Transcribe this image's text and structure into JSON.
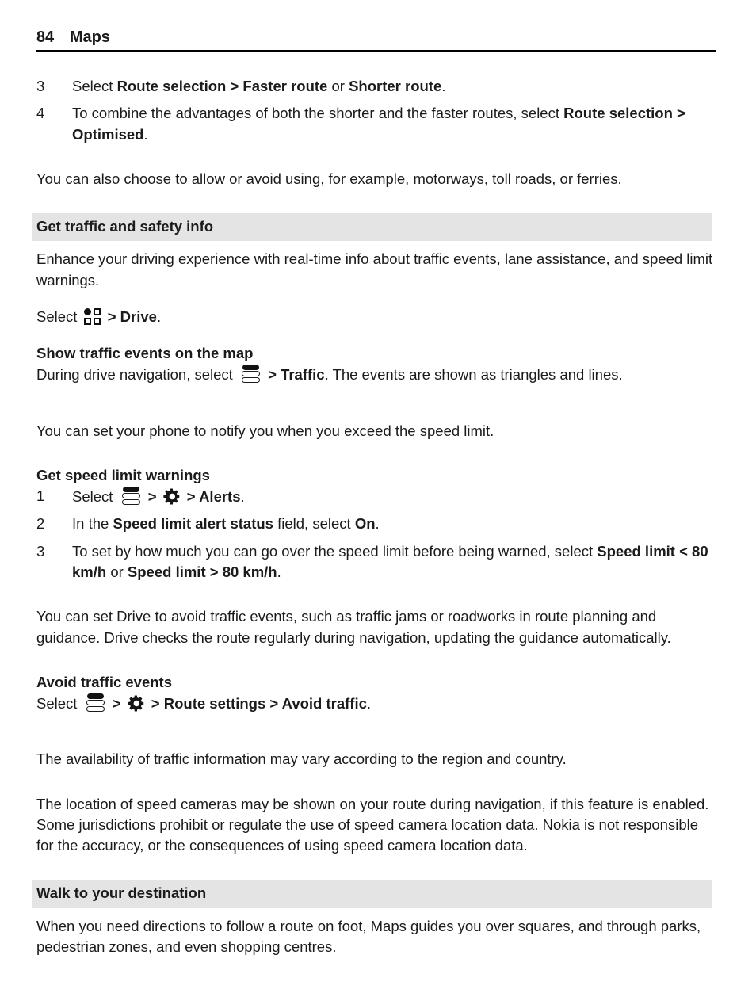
{
  "header": {
    "page_number": "84",
    "title": "Maps"
  },
  "icons": {
    "app_grid": "app-grid-icon",
    "drive_menu": "drive-menu-icon",
    "settings_gear": "gear-icon"
  },
  "content": {
    "step3_prefix": "Select ",
    "step3_bold1": "Route selection",
    "step3_sep1": " > ",
    "step3_bold2": "Faster route",
    "step3_mid": " or ",
    "step3_bold3": "Shorter route",
    "step3_suffix": ".",
    "step3_num": "3",
    "step4_num": "4",
    "step4_line1": "To combine the advantages of both the shorter and the faster routes, select",
    "step4_bold1": "Route selection",
    "step4_sep1": " > ",
    "step4_bold2": "Optimised",
    "step4_suffix": ".",
    "para_allow_avoid": "You can also choose to allow or avoid using, for example, motorways, toll roads, or ferries.",
    "heading_traffic_safety": "Get traffic and safety info",
    "para_enhance": "Enhance your driving experience with real-time info about traffic events, lane assistance, and speed limit warnings.",
    "select_word": "Select",
    "drive_sep": " > ",
    "drive_bold": "Drive",
    "drive_suffix": ".",
    "subheading_show_traffic": "Show traffic events on the map",
    "show_traffic_prefix": "During drive navigation, select ",
    "show_traffic_sep": " > ",
    "show_traffic_bold": "Traffic",
    "show_traffic_suffix": ". The events are shown as triangles and lines.",
    "para_notify_speed": "You can set your phone to notify you when you exceed the speed limit.",
    "subheading_speed_warnings": "Get speed limit warnings",
    "sl_step1_num": "1",
    "sl_step1_prefix": "Select ",
    "sl_step1_sep1": " > ",
    "sl_step1_sep2": " > ",
    "sl_step1_bold": "Alerts",
    "sl_step1_suffix": ".",
    "sl_step2_num": "2",
    "sl_step2_prefix": "In the ",
    "sl_step2_bold1": "Speed limit alert status",
    "sl_step2_mid": " field, select ",
    "sl_step2_bold2": "On",
    "sl_step2_suffix": ".",
    "sl_step3_num": "3",
    "sl_step3_line1": "To set by how much you can go over the speed limit before being warned, select",
    "sl_step3_bold1": "Speed limit < 80 km/h",
    "sl_step3_mid": " or ",
    "sl_step3_bold2": "Speed limit > 80 km/h",
    "sl_step3_suffix": ".",
    "para_avoid_intro": "You can set Drive to avoid traffic events, such as traffic jams or roadworks in route planning and guidance. Drive checks the route regularly during navigation, updating the guidance automatically.",
    "subheading_avoid_traffic": "Avoid traffic events",
    "avoid_prefix": "Select ",
    "avoid_sep1": " > ",
    "avoid_sep2": " > ",
    "avoid_bold1": "Route settings",
    "avoid_sep3": " > ",
    "avoid_bold2": "Avoid traffic",
    "avoid_suffix": ".",
    "para_availability": "The availability of traffic information may vary according to the region and country.",
    "para_speed_cameras": "The location of speed cameras may be shown on your route during navigation, if this feature is enabled. Some jurisdictions prohibit or regulate the use of speed camera location data. Nokia is not responsible for the accuracy, or the consequences of using speed camera location data.",
    "heading_walk": "Walk to your destination",
    "para_walk": "When you need directions to follow a route on foot, Maps guides you over squares, and through parks, pedestrian zones, and even shopping centres."
  },
  "colors": {
    "text": "#1b1b1b",
    "band_background": "#e4e4e4",
    "rule": "#000000",
    "page_background": "#ffffff"
  }
}
